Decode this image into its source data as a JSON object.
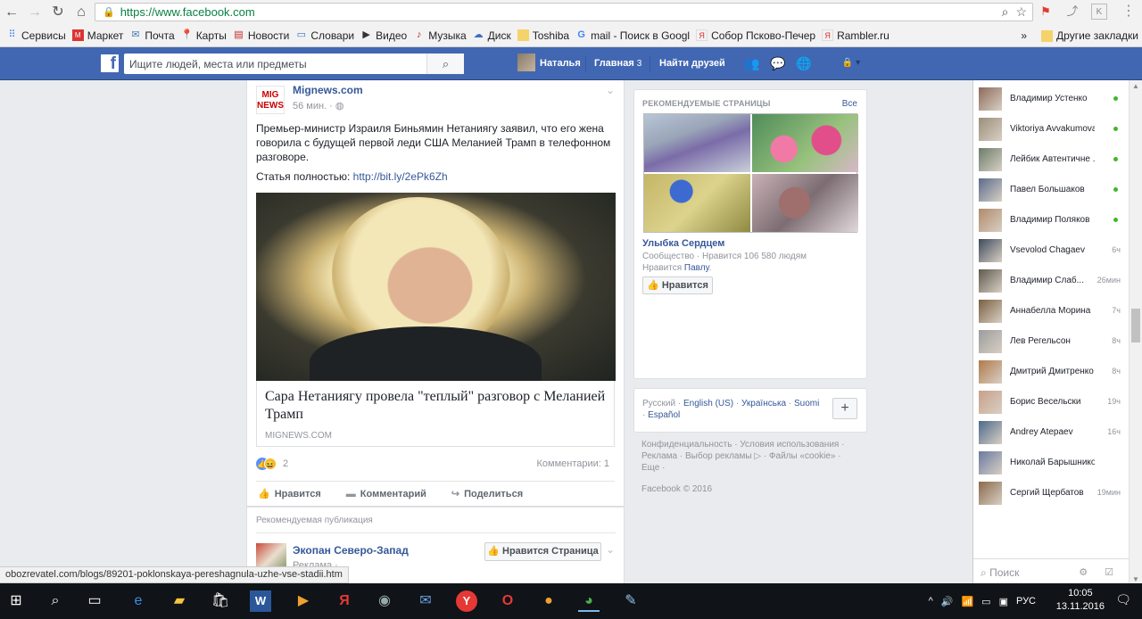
{
  "browser": {
    "url_host": "https://www.facebook.com",
    "url_rest": ""
  },
  "bookmarks": {
    "items": [
      "Сервисы",
      "Маркет",
      "Почта",
      "Карты",
      "Новости",
      "Словари",
      "Видео",
      "Музыка",
      "Диск",
      "Toshiba",
      "mail - Поиск в Googl",
      "Собор Псково-Печер",
      "Rambler.ru"
    ],
    "more": "»",
    "other": "Другие закладки"
  },
  "fb": {
    "logo": "f",
    "search_placeholder": "Ищите людей, места или предметы",
    "user_name": "Наталья",
    "home_label": "Главная",
    "home_badge": "3",
    "find_friends": "Найти друзей"
  },
  "post": {
    "author": "Mignews.com",
    "logo_line1": "MIG",
    "logo_line2": "NEWS",
    "time": "56 мин. ·",
    "text": "Премьер-министр Израиля Биньямин Нетаниягу заявил, что его жена говорила с будущей первой леди США Меланией Трамп в телефонном разговоре.",
    "link_prefix": "Статья полностью: ",
    "link_url": "http://bit.ly/2ePk6Zh",
    "link_title": "Сара Нетаниягу провела \"теплый\" разговор с Меланией Трамп",
    "link_domain": "MIGNEWS.COM",
    "reaction_count": "2",
    "comments": "Комментарии: 1",
    "action_like": "Нравится",
    "action_comment": "Комментарий",
    "action_share": "Поделиться"
  },
  "recommended": {
    "label": "Рекомендуемая публикация",
    "page_name": "Экопан Северо-Запад",
    "page_sub": "Реклама ·",
    "like_page_button": "Нравится Страница"
  },
  "rhs": {
    "title": "РЕКОМЕНДУЕМЫЕ СТРАНИЦЫ",
    "all": "Все",
    "page_name": "Улыбка Сердцем",
    "page_meta1": "Сообщество · Нравится 106 580 людям",
    "page_meta2_prefix": "Нравится ",
    "page_meta2_link": "Павлу",
    "page_meta2_suffix": ".",
    "like_button": "Нравится",
    "langs": {
      "current": "Русский",
      "l1": "English (US)",
      "l2": "Українська",
      "l3": "Suomi",
      "l4": "Español"
    },
    "footer": "Конфиденциальность · Условия использования · Реклама · Выбор рекламы ▷ · Файлы «cookie» · Еще ·",
    "copyright": "Facebook © 2016"
  },
  "chat": {
    "contacts": [
      {
        "name": "Владимир Устенко",
        "status": "",
        "online": true,
        "color": "#8c6b5a"
      },
      {
        "name": "Viktoriya Avvakumova",
        "status": "",
        "online": true,
        "color": "#9b8e7a"
      },
      {
        "name": "Лейбик Автентичне ...",
        "status": "",
        "online": true,
        "color": "#6b7d6a"
      },
      {
        "name": "Павел Большаков",
        "status": "",
        "online": true,
        "color": "#5a6b8c"
      },
      {
        "name": "Владимир Поляков",
        "status": "",
        "online": true,
        "color": "#b08a6a"
      },
      {
        "name": "Vsevolod Chagaev",
        "status": "6ч",
        "online": false,
        "color": "#3d4a5c"
      },
      {
        "name": "Владимир Слаб...",
        "status": "26мин",
        "online": false,
        "color": "#5e5a4c"
      },
      {
        "name": "Аннабелла Морина",
        "status": "7ч",
        "online": false,
        "color": "#7a6040"
      },
      {
        "name": "Лев Регельсон",
        "status": "8ч",
        "online": false,
        "color": "#9c9c9c"
      },
      {
        "name": "Дмитрий Дмитренко",
        "status": "8ч",
        "online": false,
        "color": "#b07a4a"
      },
      {
        "name": "Борис Весельски",
        "status": "19ч",
        "online": false,
        "color": "#c8a088"
      },
      {
        "name": "Andrey Atepaev",
        "status": "16ч",
        "online": false,
        "color": "#4c6a8a"
      },
      {
        "name": "Николай Барышников",
        "status": "",
        "online": false,
        "color": "#6a7aa0"
      },
      {
        "name": "Сергий Щербатов",
        "status": "19мин",
        "online": false,
        "color": "#8a6a4a"
      }
    ],
    "search_placeholder": "Поиск"
  },
  "statusbar": "obozrevatel.com/blogs/89201-poklonskaya-pereshagnula-uzhe-vse-stadii.htm",
  "taskbar": {
    "lang": "РУС",
    "time": "10:05",
    "date": "13.11.2016"
  }
}
